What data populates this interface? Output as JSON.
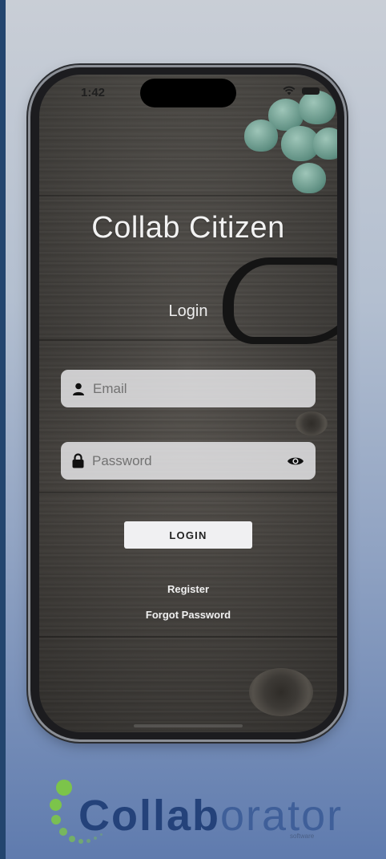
{
  "status_bar": {
    "time": "1:42"
  },
  "app": {
    "title": "Collab Citizen",
    "subtitle": "Login"
  },
  "form": {
    "email_placeholder": "Email",
    "password_placeholder": "Password",
    "login_label": "LOGIN"
  },
  "links": {
    "register": "Register",
    "forgot_password": "Forgot Password"
  },
  "brand": {
    "logo_bold": "Collab",
    "logo_light": "orator",
    "logo_sub": "software"
  },
  "colors": {
    "logo_blue": "#24427a",
    "logo_green": "#7cc44a",
    "field_bg": "#ecececd1",
    "button_bg": "#f0f0f2"
  },
  "icons": [
    "person-icon",
    "lock-icon",
    "eye-icon",
    "wifi-icon",
    "battery-icon"
  ]
}
